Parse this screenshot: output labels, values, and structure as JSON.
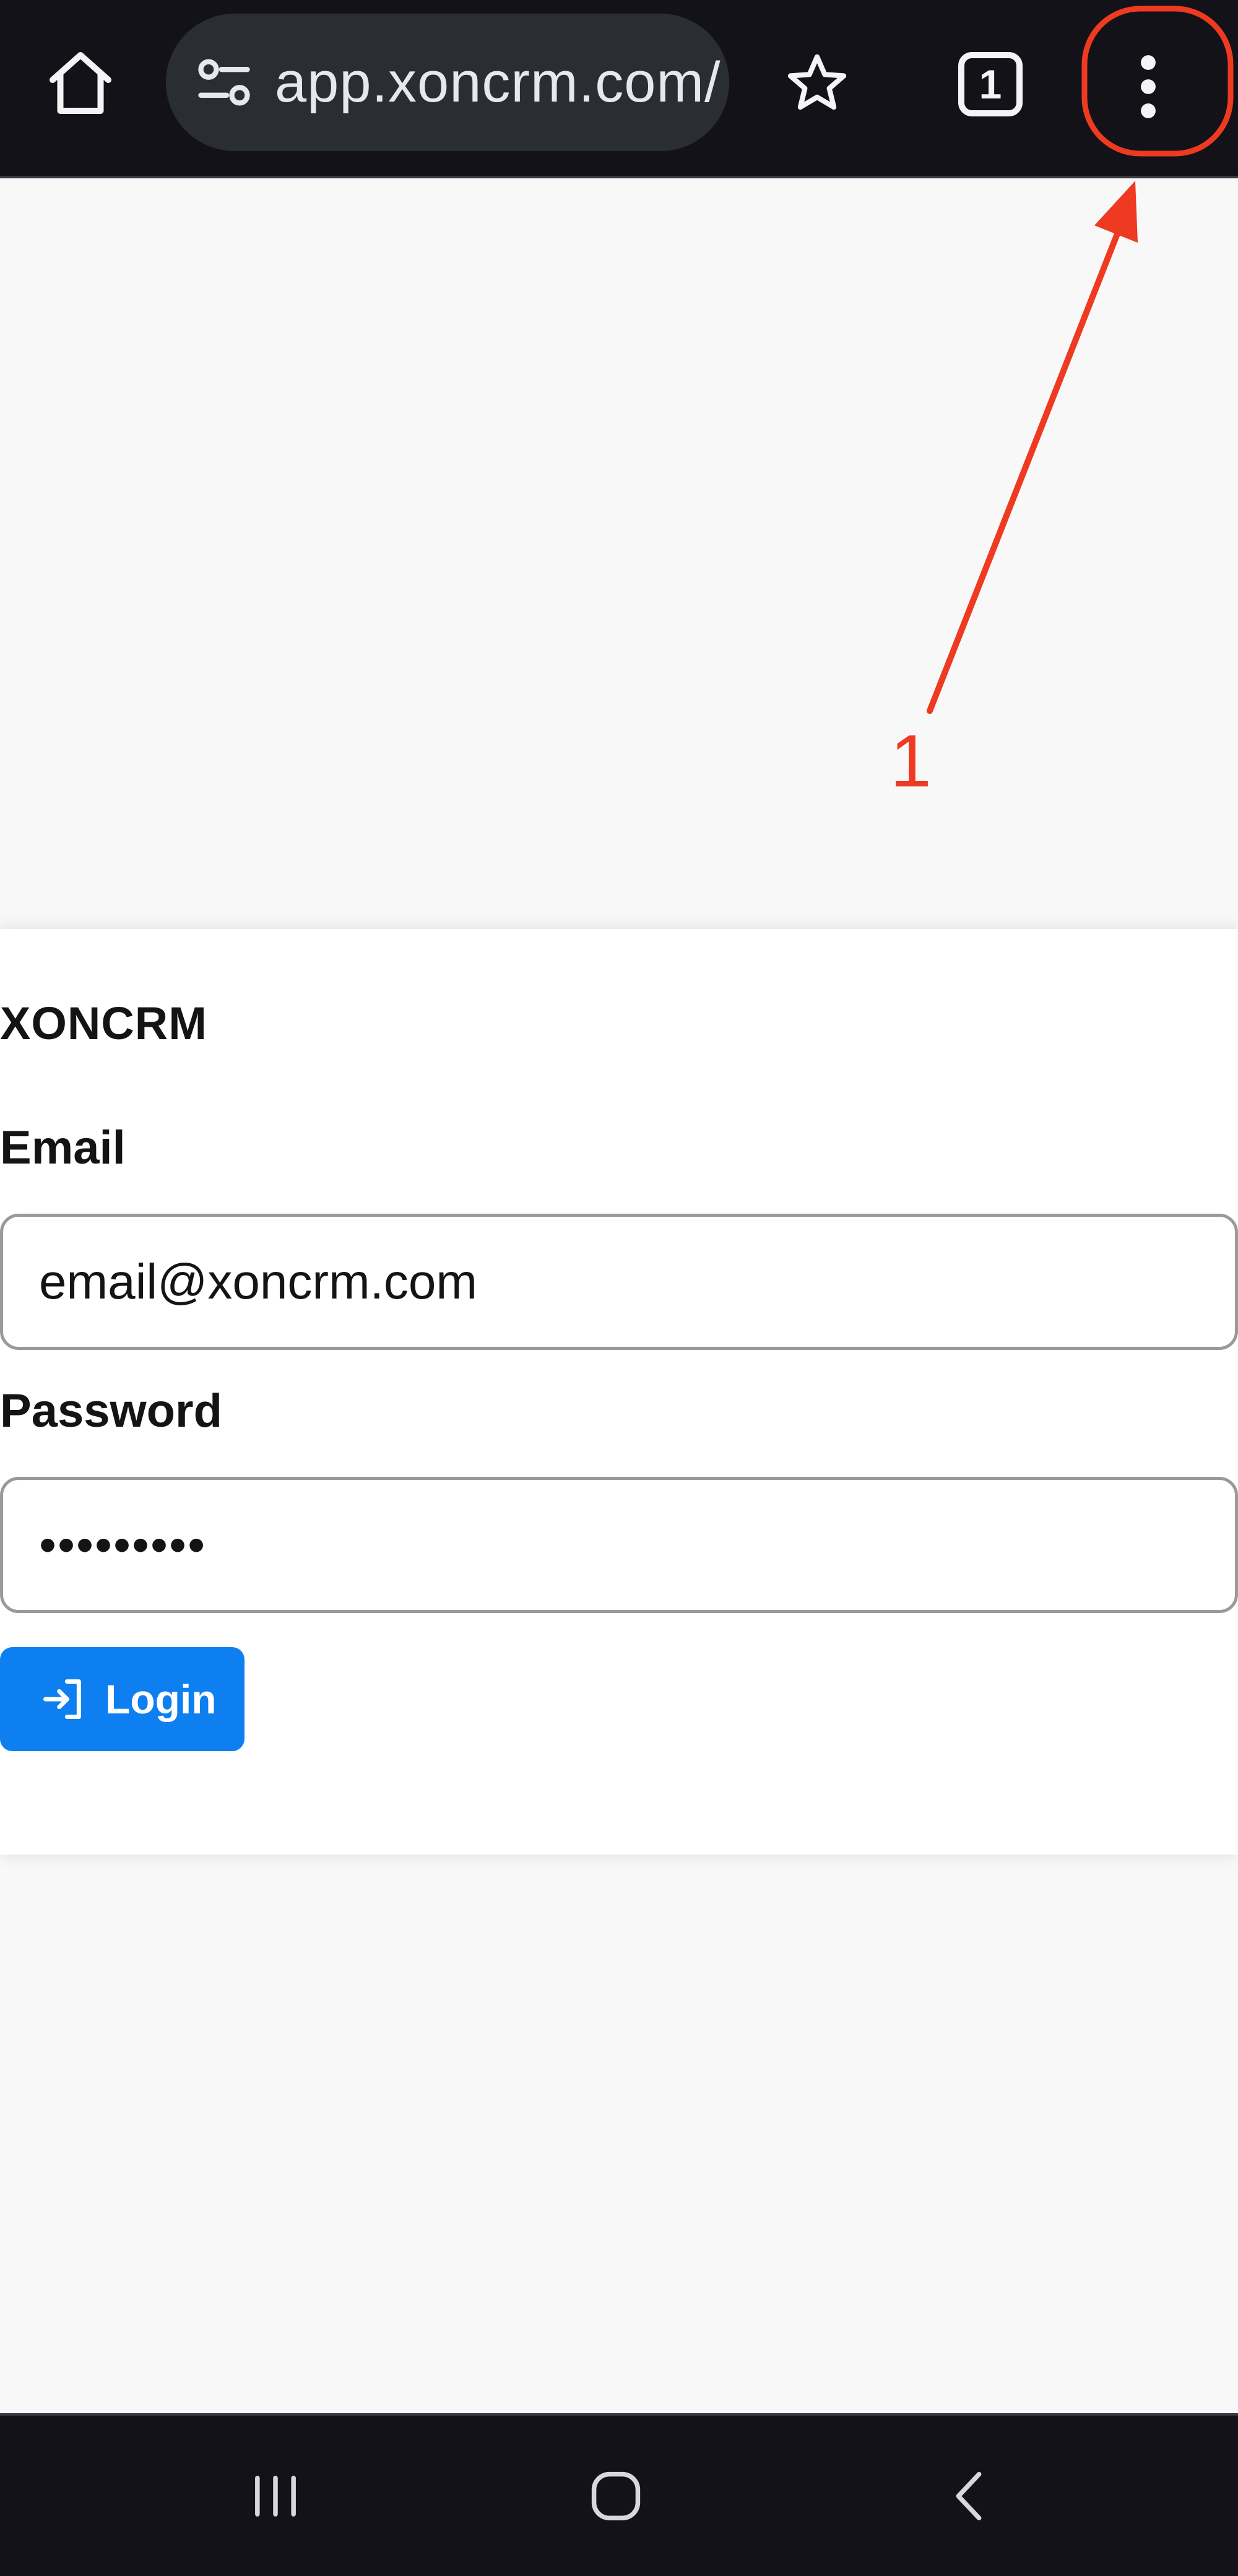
{
  "browser": {
    "url": "app.xoncrm.com/",
    "tab_count": "1",
    "icons": {
      "home": "home-icon",
      "site_settings": "tune-icon",
      "bookmark": "star-icon",
      "tabs": "tabs-icon",
      "menu": "more-vert-icon"
    }
  },
  "annotation": {
    "number": "1",
    "color": "#ee3a20"
  },
  "login": {
    "brand": "XONCRM",
    "email_label": "Email",
    "email_value": "email@xoncrm.com",
    "password_label": "Password",
    "password_value": "•••••••••",
    "button_label": "Login",
    "button_color": "#0d7ff0"
  },
  "system_nav": {
    "icons": {
      "recents": "recents-icon",
      "home": "home-circle-icon",
      "back": "back-chevron-icon"
    }
  }
}
